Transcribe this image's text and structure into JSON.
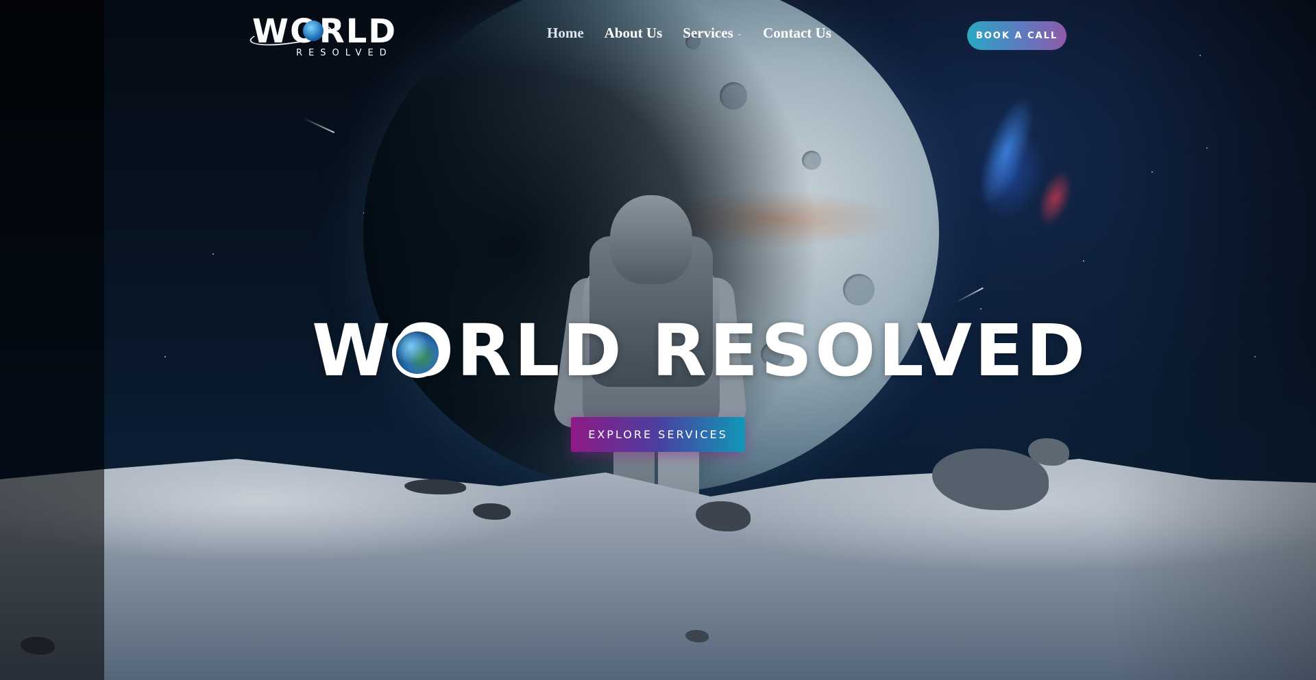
{
  "header": {
    "logo": {
      "word": "WORLD",
      "sub": "RESOLVED"
    },
    "nav": [
      {
        "label": "Home"
      },
      {
        "label": "About Us"
      },
      {
        "label": "Services",
        "icon": "chevron-down-icon"
      },
      {
        "label": "Contact Us"
      }
    ],
    "cta_label": "BOOK A CALL"
  },
  "hero": {
    "title": "WORLD RESOLVED",
    "button_label": "EXPLORE SERVICES"
  },
  "colors": {
    "book_gradient": [
      "#2aa7c2",
      "#8e5aa8"
    ],
    "explore_gradient": [
      "#8e1a86",
      "#1098b8"
    ]
  }
}
